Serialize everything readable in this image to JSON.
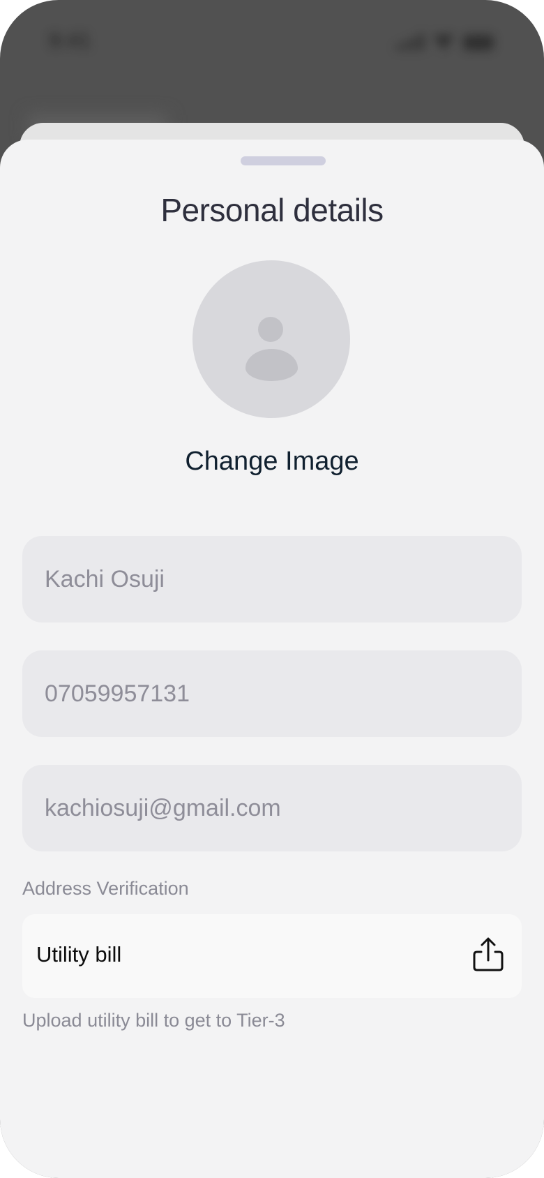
{
  "status_bar": {
    "time": "9:41"
  },
  "sheet": {
    "title": "Personal details",
    "change_image_label": "Change Image",
    "fields": {
      "name_value": "Kachi Osuji",
      "phone_value": "07059957131",
      "email_value": "kachiosuji@gmail.com"
    },
    "address_section_label": "Address Verification",
    "utility_bill": {
      "label": "Utility bill",
      "icon": "upload-icon"
    },
    "helper_text": "Upload utility bill to get to Tier-3"
  },
  "colors": {
    "backdrop": "#515151",
    "sheet_background": "#f3f3f4",
    "field_background": "#e9e9ec",
    "title_text": "#2e2f3d",
    "muted_text": "#8a8a95",
    "grabber": "#cfcfdf"
  }
}
